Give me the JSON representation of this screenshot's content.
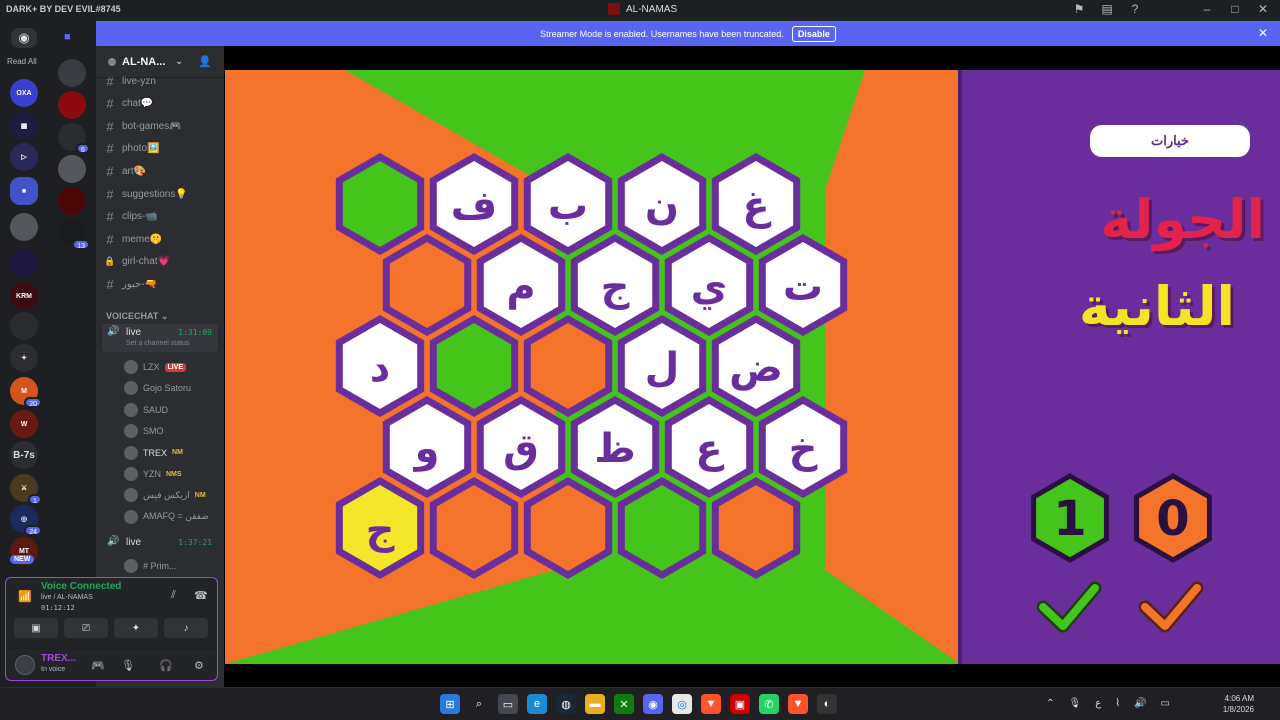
{
  "titlebar": {
    "brand": "DARK+ BY DEV EVIL#8745",
    "window_title": "AL-NAMAS"
  },
  "rail": {
    "read_all": "Read All",
    "text_server": "B-7s",
    "new_badge": "NEW",
    "badges": [
      "6",
      "13",
      "20",
      "1",
      "24"
    ]
  },
  "banner": {
    "message": "Streamer Mode is enabled. Usernames have been truncated.",
    "disable_label": "Disable"
  },
  "server": {
    "name": "AL-NA..."
  },
  "channels": [
    {
      "label": "live-yzn",
      "icon": "hash-icon"
    },
    {
      "label": "chat💬",
      "icon": "hash-icon"
    },
    {
      "label": "bot-games🎮",
      "icon": "hash-icon"
    },
    {
      "label": "photo🖼️",
      "icon": "hash-icon"
    },
    {
      "label": "art🎨",
      "icon": "hash-icon"
    },
    {
      "label": "suggestions💡",
      "icon": "hash-icon"
    },
    {
      "label": "clips-📹",
      "icon": "hash-icon"
    },
    {
      "label": "meme🤫",
      "icon": "hash-icon"
    },
    {
      "label": "girl-chat💗",
      "icon": "lock-icon"
    },
    {
      "label": "حبور-🔫",
      "icon": "hash-icon"
    }
  ],
  "voice": {
    "category": "VOICECHAT",
    "channel1": {
      "name": "live",
      "time": "1:31:09",
      "status": "Set a channel status"
    },
    "users": [
      {
        "name": "LZX",
        "tag": "LIVE"
      },
      {
        "name": "Gojo Satoru",
        "tag": ""
      },
      {
        "name": "SAUD",
        "tag": ""
      },
      {
        "name": "SMO",
        "tag": ""
      },
      {
        "name": "TREX",
        "tag": "NM"
      },
      {
        "name": "YZN",
        "tag": "NMS"
      },
      {
        "name": "اريكس فيس",
        "tag": "NM"
      },
      {
        "name": "AMAFQ = ضفقن",
        "tag": ""
      }
    ],
    "channel2": {
      "name": "live",
      "time": "1:37:21"
    },
    "channel2_user": "# Prim..."
  },
  "voice_panel": {
    "title": "Voice Connected",
    "sub": "live / AL-NAMAS",
    "time": "01:12:12",
    "me_name": "TREX...",
    "me_status": "In voice"
  },
  "game": {
    "options_label": "خيارات",
    "round_line1": "الجولة",
    "round_line2": "الثانية",
    "score_green": "1",
    "score_orange": "0",
    "colors": {
      "green": "#45c41b",
      "orange": "#f4742c",
      "purple": "#6a2d9c",
      "yellow": "#f3e72c"
    },
    "cells": [
      [
        "green",
        "ف",
        "ب",
        "ن",
        "غ"
      ],
      [
        "orange",
        "م",
        "ج",
        "ي",
        "ت"
      ],
      [
        "د",
        "green",
        "orange",
        "ل",
        "ض"
      ],
      [
        "و",
        "ق",
        "ظ",
        "ع",
        "خ"
      ],
      [
        "yellow:ج",
        "orange",
        "orange",
        "green",
        "orange"
      ]
    ]
  },
  "taskbar": {
    "time": "4:06 AM",
    "date": "1/8/2026",
    "lang": "ع"
  }
}
